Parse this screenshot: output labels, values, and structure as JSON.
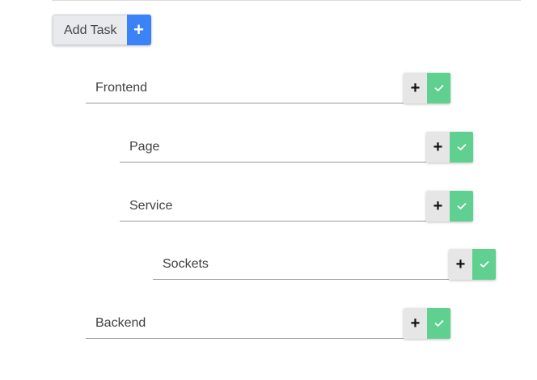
{
  "toolbar": {
    "add_task_label": "Add Task",
    "add_icon_glyph": "+"
  },
  "tasks": [
    {
      "label": "Frontend",
      "level": 0,
      "plus_glyph": "+"
    },
    {
      "label": "Page",
      "level": 1,
      "plus_glyph": "+"
    },
    {
      "label": "Service",
      "level": 1,
      "plus_glyph": "+"
    },
    {
      "label": "Sockets",
      "level": 2,
      "plus_glyph": "+"
    },
    {
      "label": "Backend",
      "level": 0,
      "plus_glyph": "+"
    }
  ],
  "colors": {
    "accent_blue": "#3b82f6",
    "complete_green": "#5fd08f",
    "add_grey": "#e6e6e6"
  },
  "icons": {
    "add_task": "plus-icon",
    "add_subtask": "plus-icon",
    "complete": "check-icon"
  }
}
